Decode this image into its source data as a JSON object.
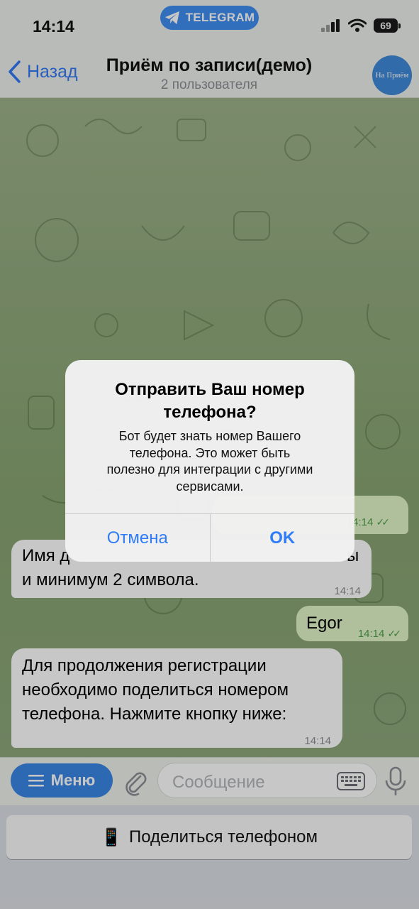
{
  "status_bar": {
    "time": "14:14",
    "pill_label": "TELEGRAM",
    "battery": "69",
    "icons": [
      "signal-icon",
      "wifi-icon",
      "battery-icon"
    ]
  },
  "header": {
    "back_label": "Назад",
    "title": "Приём по записи(демо)",
    "subtitle": "2 пользователя",
    "avatar_text": "На Приём"
  },
  "messages": [
    {
      "direction": "out",
      "text": "",
      "time": "14:14"
    },
    {
      "direction": "in",
      "line1_visible": "Имя д",
      "line1_tail": "ы",
      "line2": "и минимум 2 символа.",
      "time": "14:14"
    },
    {
      "direction": "out",
      "text": "Egor",
      "time": "14:14"
    },
    {
      "direction": "in",
      "text": "Для продолжения регистрации необходимо поделиться номером телефона. Нажмите кнопку ниже:",
      "lines": [
        "Для продолжения регистрации",
        "необходимо поделиться номером",
        "телефона. Нажмите кнопку ниже:"
      ],
      "time": "14:14"
    }
  ],
  "input_bar": {
    "menu_label": "Меню",
    "placeholder": "Сообщение"
  },
  "keyboard": {
    "share_button_label": "Поделиться телефоном",
    "share_button_emoji": "📱"
  },
  "dialog": {
    "title_line1": "Отправить Ваш номер",
    "title_line2": "телефона?",
    "body_lines": [
      "Бот будет знать номер Вашего",
      "телефона. Это может быть",
      "полезно для интеграции с другими",
      "сервисами."
    ],
    "cancel_label": "Отмена",
    "ok_label": "OK"
  },
  "colors": {
    "accent": "#3478f6",
    "outgoing_bubble": "#e3f6c8",
    "incoming_bubble": "#ffffff",
    "chat_background": "#93ab7f"
  }
}
